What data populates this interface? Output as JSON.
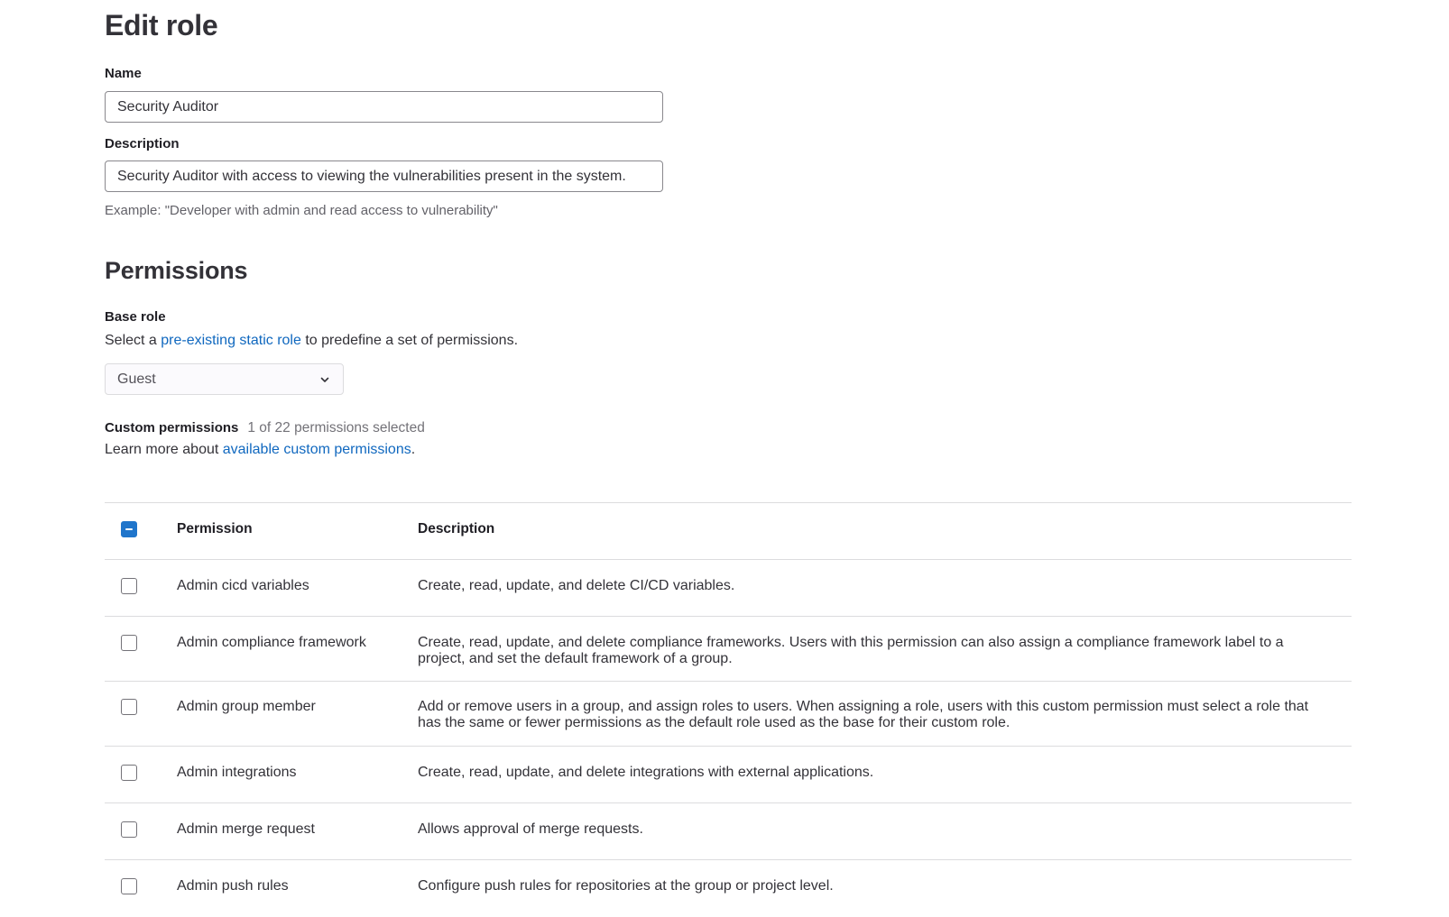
{
  "page": {
    "title": "Edit role"
  },
  "form": {
    "name_label": "Name",
    "name_value": "Security Auditor",
    "description_label": "Description",
    "description_value": "Security Auditor with access to viewing the vulnerabilities present in the system.",
    "description_help": "Example: \"Developer with admin and read access to vulnerability\""
  },
  "permissions": {
    "section_title": "Permissions",
    "base_role_label": "Base role",
    "base_role_help_prefix": "Select a ",
    "base_role_help_link": "pre-existing static role",
    "base_role_help_suffix": " to predefine a set of permissions.",
    "base_role_selected": "Guest",
    "custom_label": "Custom permissions",
    "custom_count": "1 of 22 permissions selected",
    "learn_more_prefix": "Learn more about ",
    "learn_more_link": "available custom permissions",
    "learn_more_suffix": "."
  },
  "table": {
    "header_permission": "Permission",
    "header_description": "Description",
    "select_all_state": "indeterminate",
    "rows": [
      {
        "permission": "Admin cicd variables",
        "description": "Create, read, update, and delete CI/CD variables.",
        "checked": false
      },
      {
        "permission": "Admin compliance framework",
        "description": "Create, read, update, and delete compliance frameworks. Users with this permission can also assign a compliance framework label to a project, and set the default framework of a group.",
        "checked": false
      },
      {
        "permission": "Admin group member",
        "description": "Add or remove users in a group, and assign roles to users. When assigning a role, users with this custom permission must select a role that has the same or fewer permissions as the default role used as the base for their custom role.",
        "checked": false
      },
      {
        "permission": "Admin integrations",
        "description": "Create, read, update, and delete integrations with external applications.",
        "checked": false
      },
      {
        "permission": "Admin merge request",
        "description": "Allows approval of merge requests.",
        "checked": false
      },
      {
        "permission": "Admin push rules",
        "description": "Configure push rules for repositories at the group or project level.",
        "checked": false
      }
    ]
  },
  "colors": {
    "link": "#1068bf",
    "checkbox_accent": "#1f75cb"
  },
  "icons": {
    "select_chevron": "chevron-down-icon",
    "select_all_state_icon": "minus-icon"
  }
}
